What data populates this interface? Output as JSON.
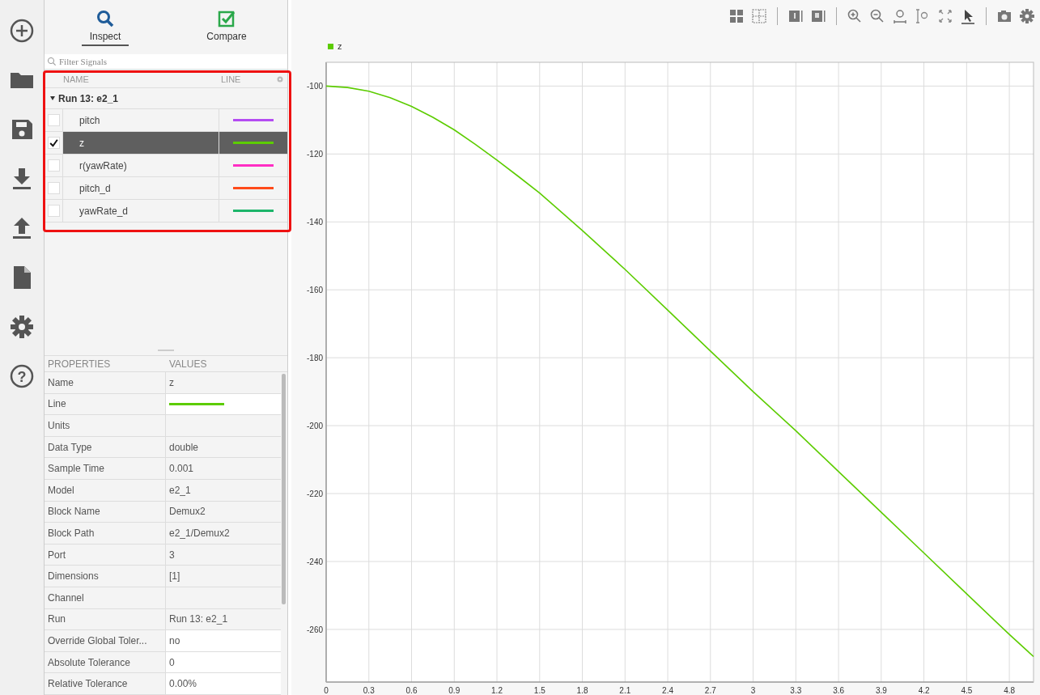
{
  "rail": {
    "help_glyph": "?"
  },
  "tabs": [
    {
      "label": "Inspect",
      "kind": "inspect",
      "selected": true
    },
    {
      "label": "Compare",
      "kind": "compare",
      "selected": false
    }
  ],
  "filter": {
    "placeholder": "Filter Signals"
  },
  "signal_table": {
    "columns": [
      "NAME",
      "LINE"
    ],
    "run": {
      "label": "Run 13: e2_1",
      "expanded": true
    },
    "rows": [
      {
        "name": "pitch",
        "checked": false,
        "selected": false,
        "color": "#b44cf2"
      },
      {
        "name": "z",
        "checked": true,
        "selected": true,
        "color": "#5ccc00"
      },
      {
        "name": "r(yawRate)",
        "checked": false,
        "selected": false,
        "color": "#ff2ec4"
      },
      {
        "name": "pitch_d",
        "checked": false,
        "selected": false,
        "color": "#ff4a1a"
      },
      {
        "name": "yawRate_d",
        "checked": false,
        "selected": false,
        "color": "#1db56a"
      }
    ]
  },
  "properties": {
    "columns": [
      "PROPERTIES",
      "VALUES"
    ],
    "rows": [
      {
        "kind": "text",
        "name": "Name",
        "value": "z"
      },
      {
        "kind": "line",
        "name": "Line",
        "color": "#5ccc00"
      },
      {
        "kind": "text",
        "name": "Units"
      },
      {
        "kind": "text",
        "name": "Data Type",
        "value": "double"
      },
      {
        "kind": "text",
        "name": "Sample Time",
        "value": "0.001"
      },
      {
        "kind": "text",
        "name": "Model",
        "value": "e2_1"
      },
      {
        "kind": "text",
        "name": "Block Name",
        "value": "Demux2"
      },
      {
        "kind": "text",
        "name": "Block Path",
        "value": "e2_1/Demux2"
      },
      {
        "kind": "text",
        "name": "Port",
        "value": "3"
      },
      {
        "kind": "text",
        "name": "Dimensions",
        "value": "[1]"
      },
      {
        "kind": "text",
        "name": "Channel"
      },
      {
        "kind": "text",
        "name": "Run",
        "value": "Run 13: e2_1"
      },
      {
        "kind": "text",
        "name": "Override Global Toler...",
        "value": "no"
      },
      {
        "kind": "text",
        "name": "Absolute Tolerance",
        "value": "0"
      },
      {
        "kind": "text",
        "name": "Relative Tolerance",
        "value": "0.00%"
      }
    ]
  },
  "plot": {
    "chart_data": {
      "type": "line",
      "x": [
        0,
        0.15,
        0.3,
        0.45,
        0.6,
        0.75,
        0.9,
        1.05,
        1.2,
        1.35,
        1.5,
        1.8,
        2.1,
        2.4,
        2.7,
        3.0,
        3.3,
        3.6,
        3.9,
        4.2,
        4.5,
        4.8,
        4.97
      ],
      "series": [
        {
          "name": "z",
          "color": "#5ccc00",
          "values": [
            -100,
            -100.4,
            -101.5,
            -103.4,
            -106,
            -109.2,
            -112.9,
            -117.2,
            -121.8,
            -126.6,
            -131.5,
            -142.5,
            -154,
            -166,
            -178,
            -190,
            -201.5,
            -213.5,
            -225.5,
            -237.5,
            -249.5,
            -261.5,
            -268
          ]
        }
      ],
      "grid": true,
      "xlim": [
        0,
        4.97
      ],
      "ylim": [
        -275.5,
        -93
      ],
      "xticks": [
        0,
        0.3,
        0.6,
        0.9,
        1.2,
        1.5,
        1.8,
        2.1,
        2.4,
        2.7,
        3.0,
        3.3,
        3.6,
        3.9,
        4.2,
        4.5,
        4.8
      ],
      "yticks": [
        -100,
        -120,
        -140,
        -160,
        -180,
        -200,
        -220,
        -240,
        -260
      ]
    }
  }
}
